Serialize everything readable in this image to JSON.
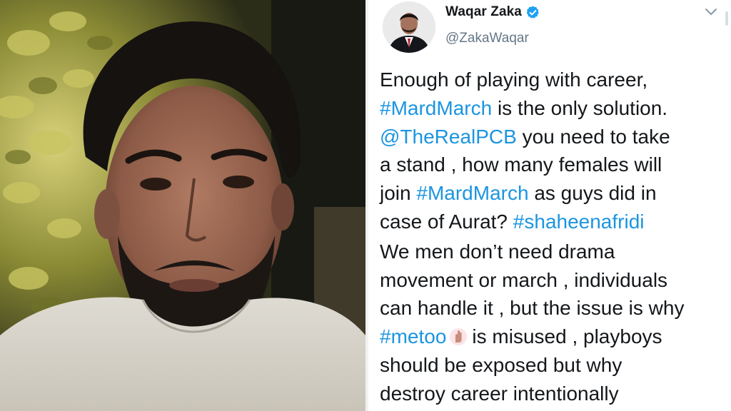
{
  "tweet": {
    "display_name": "Waqar Zaka",
    "handle": "@ZakaWaqar",
    "verified_icon": "verified-badge-icon",
    "menu_icon": "chevron-down-icon",
    "link_color": "#1b95e0",
    "text_color": "#14171a",
    "handle_color": "#657786",
    "paragraph1": {
      "l1": "Enough of playing with career,",
      "l2_tag": "#MardMarch",
      "l2_rest": " is the only solution.",
      "l3_mention": "@TheRealPCB",
      "l3_rest": " you need to take",
      "l4": "a stand , how many females will",
      "l5_pre": "join ",
      "l5_tag": "#MardMarch",
      "l5_rest": " as guys did in",
      "l6_pre": "case of Aurat? ",
      "l6_tag": "#shaheenafridi"
    },
    "paragraph2": {
      "l1": "We men don’t need drama",
      "l2": "movement or march , individuals",
      "l3": "can handle it , but the issue is why",
      "l4_tag": "#metoo",
      "l4_emoji": "raised-hand-emoji-icon",
      "l4_rest": "is misused , playboys",
      "l5": "should be exposed but why",
      "l6": "destroy career intentionally"
    }
  }
}
